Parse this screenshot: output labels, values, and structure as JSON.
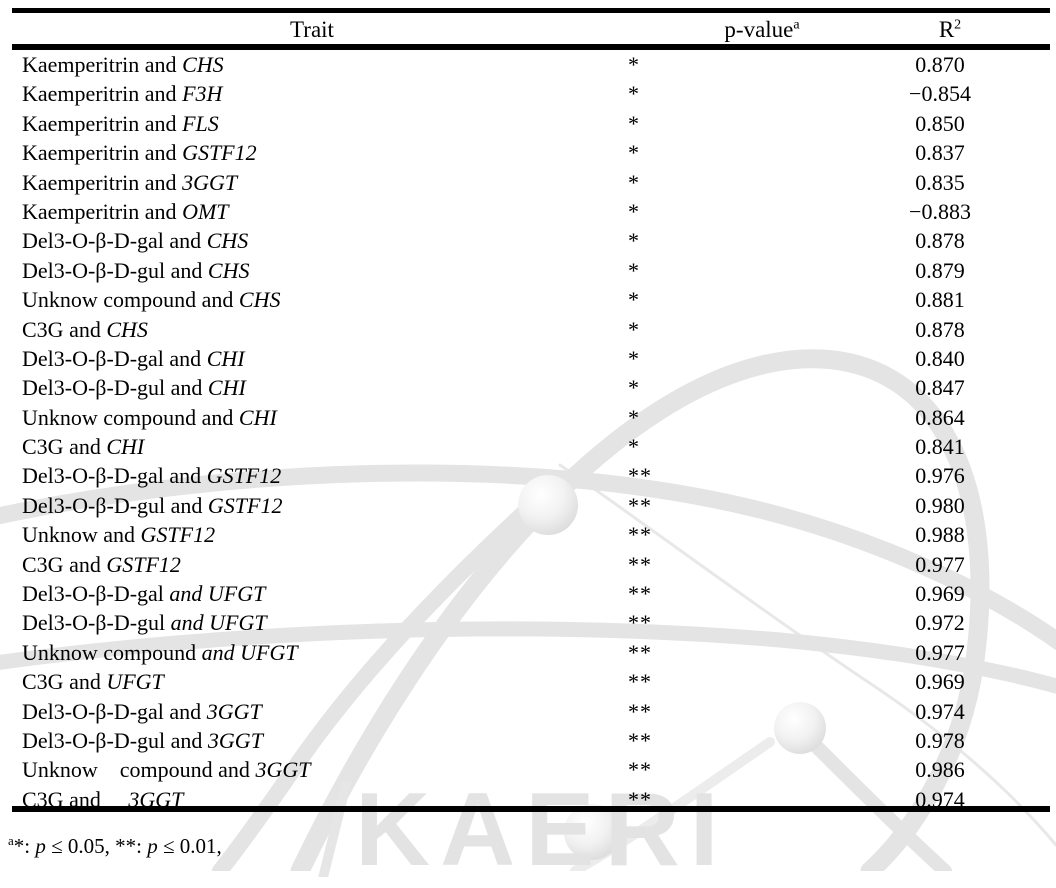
{
  "table": {
    "headers": {
      "trait": "Trait",
      "pvalue": "p-value",
      "pvalue_sup": "a",
      "r2": "R",
      "r2_sup": "2"
    },
    "rows": [
      {
        "compound": "Kaemperitrin",
        "conj": "and",
        "gene": "CHS",
        "p": "*",
        "r2": "0.870"
      },
      {
        "compound": "Kaemperitrin",
        "conj": "and",
        "gene": "F3H",
        "p": "*",
        "r2": "−0.854"
      },
      {
        "compound": "Kaemperitrin",
        "conj": "and",
        "gene": "FLS",
        "p": "*",
        "r2": "0.850"
      },
      {
        "compound": "Kaemperitrin",
        "conj": "and",
        "gene": "GSTF12",
        "p": "*",
        "r2": "0.837"
      },
      {
        "compound": "Kaemperitrin",
        "conj": "and",
        "gene": "3GGT",
        "p": "*",
        "r2": "0.835"
      },
      {
        "compound": "Kaemperitrin",
        "conj": "and",
        "gene": "OMT",
        "p": "*",
        "r2": "−0.883"
      },
      {
        "compound": "Del3-O-β-D-gal",
        "conj": "and",
        "gene": "CHS",
        "p": "*",
        "r2": "0.878"
      },
      {
        "compound": "Del3-O-β-D-gul",
        "conj": "and",
        "gene": "CHS",
        "p": "*",
        "r2": "0.879"
      },
      {
        "compound": "Unknow compound",
        "conj": "and",
        "gene": "CHS",
        "p": "*",
        "r2": "0.881"
      },
      {
        "compound": "C3G",
        "conj": "and",
        "gene": "CHS",
        "p": "*",
        "r2": "0.878"
      },
      {
        "compound": "Del3-O-β-D-gal",
        "conj": "and",
        "gene": "CHI",
        "p": "*",
        "r2": "0.840"
      },
      {
        "compound": "Del3-O-β-D-gul",
        "conj": "and",
        "gene": "CHI",
        "p": "*",
        "r2": "0.847"
      },
      {
        "compound": "Unknow compound",
        "conj": "and",
        "gene": "CHI",
        "p": "*",
        "r2": "0.864"
      },
      {
        "compound": "C3G",
        "conj": "and",
        "gene": "CHI",
        "p": "*",
        "r2": "0.841"
      },
      {
        "compound": "Del3-O-β-D-gal",
        "conj": "and",
        "gene": "GSTF12",
        "p": "**",
        "r2": "0.976"
      },
      {
        "compound": "Del3-O-β-D-gul",
        "conj": "and",
        "gene": "GSTF12",
        "p": "**",
        "r2": "0.980"
      },
      {
        "compound": "Unknow",
        "conj": "and",
        "gene": "GSTF12",
        "p": "**",
        "r2": "0.988"
      },
      {
        "compound": "C3G",
        "conj": "and",
        "gene": "GSTF12",
        "p": "**",
        "r2": "0.977"
      },
      {
        "compound": "Del3-O-β-D-gal",
        "conj": "and",
        "conj_italic": true,
        "gene": "UFGT",
        "p": "**",
        "r2": "0.969"
      },
      {
        "compound": "Del3-O-β-D-gul",
        "conj": "and",
        "conj_italic": true,
        "gene": "UFGT",
        "p": "**",
        "r2": "0.972"
      },
      {
        "compound": "Unknow compound",
        "conj": "and",
        "conj_italic": true,
        "gene": "UFGT",
        "p": "**",
        "r2": "0.977"
      },
      {
        "compound": "C3G",
        "conj": "and",
        "gene": "UFGT",
        "p": "**",
        "r2": "0.969"
      },
      {
        "compound": "Del3-O-β-D-gal",
        "conj": "and",
        "gene": "3GGT",
        "p": "**",
        "r2": "0.974"
      },
      {
        "compound": "Del3-O-β-D-gul",
        "conj": "and",
        "gene": "3GGT",
        "p": "**",
        "r2": "0.978"
      },
      {
        "compound": "Unknow",
        "extra_gap_after_compound": true,
        "compound2": "compound",
        "conj": "and",
        "gene": "3GGT",
        "p": "**",
        "r2": "0.986"
      },
      {
        "compound": "C3G",
        "conj": "and",
        "extra_gap_after_conj": true,
        "gene": "3GGT",
        "p": "**",
        "r2": "0.974"
      }
    ]
  },
  "footnote": {
    "sup": "a",
    "part1": "*: ",
    "p1": "p",
    "op1": " ≤ ",
    "val1": "0.05, ",
    "part2": "**: ",
    "p2": "p",
    "op2": " ≤ ",
    "val2": "0.01,"
  },
  "watermark": {
    "text": "KAERI",
    "color": "#e3e3e3",
    "orbit_color": "#e6e6e6"
  }
}
